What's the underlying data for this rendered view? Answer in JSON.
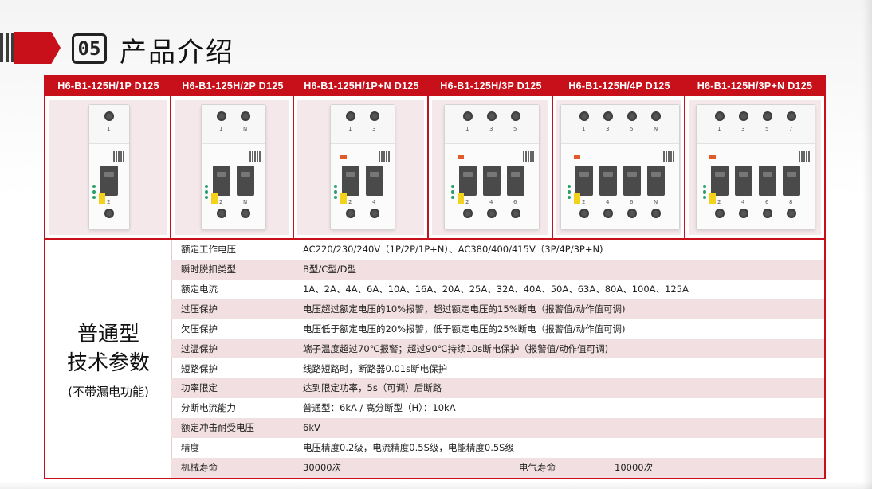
{
  "header": {
    "section_number": "05",
    "title": "产品介绍"
  },
  "colors": {
    "accent": "#c8101a",
    "row_shade": "#f2dfe1",
    "image_bg": "#f5e8ea"
  },
  "models": [
    {
      "name": "H6-B1-125H/1P D125",
      "terminals_top": [
        "1"
      ],
      "terminals_bottom": [
        "2"
      ]
    },
    {
      "name": "H6-B1-125H/2P D125",
      "terminals_top": [
        "1",
        "N"
      ],
      "terminals_bottom": [
        "2",
        "N"
      ]
    },
    {
      "name": "H6-B1-125H/1P+N D125",
      "terminals_top": [
        "1",
        "3"
      ],
      "terminals_bottom": [
        "2",
        "4"
      ]
    },
    {
      "name": "H6-B1-125H/3P D125",
      "terminals_top": [
        "1",
        "3",
        "5"
      ],
      "terminals_bottom": [
        "2",
        "4",
        "6"
      ]
    },
    {
      "name": "H6-B1-125H/4P D125",
      "terminals_top": [
        "1",
        "3",
        "5",
        "N"
      ],
      "terminals_bottom": [
        "2",
        "4",
        "6",
        "N"
      ]
    },
    {
      "name": "H6-B1-125H/3P+N D125",
      "terminals_top": [
        "1",
        "3",
        "5",
        "7"
      ],
      "terminals_bottom": [
        "2",
        "4",
        "6",
        "8"
      ]
    }
  ],
  "params_block": {
    "title_line1": "普通型",
    "title_line2": "技术参数",
    "subtitle": "(不带漏电功能)"
  },
  "params": [
    {
      "label": "额定工作电压",
      "value": "AC220/230/240V（1P/2P/1P+N）、AC380/400/415V（3P/4P/3P+N)"
    },
    {
      "label": "瞬时脱扣类型",
      "value": "B型/C型/D型"
    },
    {
      "label": "额定电流",
      "value": "1A、2A、4A、6A、10A、16A、20A、25A、32A、40A、50A、63A、80A、100A、125A"
    },
    {
      "label": "过压保护",
      "value": "电压超过额定电压的10%报警，超过额定电压的15%断电（报警值/动作值可调)"
    },
    {
      "label": "欠压保护",
      "value": "电压低于额定电压的20%报警，低于额定电压的25%断电（报警值/动作值可调)"
    },
    {
      "label": "过温保护",
      "value": "端子温度超过70℃报警；超过90℃持续10s断电保护（报警值/动作值可调)"
    },
    {
      "label": "短路保护",
      "value": "线路短路时，断路器0.01s断电保护"
    },
    {
      "label": "功率限定",
      "value": "达到限定功率，5s（可调）后断路"
    },
    {
      "label": "分断电流能力",
      "value": "普通型：6kA   /   高分断型（H）：10kA"
    },
    {
      "label": "额定冲击耐受电压",
      "value": "6kV"
    },
    {
      "label": "精度",
      "value": "电压精度0.2级，电流精度0.5S级，电能精度0.5S级"
    },
    {
      "label": "机械寿命",
      "value": "30000次",
      "extra_label": "电气寿命",
      "extra_value": "10000次"
    }
  ]
}
